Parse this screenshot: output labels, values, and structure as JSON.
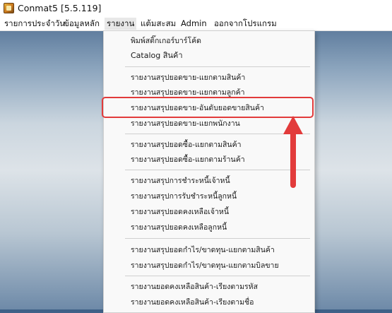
{
  "window": {
    "title": "Conmat5 [5.5.119]"
  },
  "menubar": {
    "items": [
      "รายการประจำวัน",
      "ข้อมูลหลัก",
      "รายงาน",
      "แต้มสะสม",
      "Admin",
      "ออกจากโปรแกรม"
    ],
    "active": "รายงาน"
  },
  "dropdown": {
    "items": [
      "พิมพ์สติ๊กเกอร์บาร์โค้ด",
      "Catalog สินค้า",
      "รายงานสรุปยอดขาย-แยกตามสินค้า",
      "รายงานสรุปยอดขาย-แยกตามลูกค้า",
      "รายงานสรุปยอดขาย-อันดับยอดขายสินค้า",
      "รายงานสรุปยอดขาย-แยกพนักงาน",
      "รายงานสรุปยอดซื้อ-แยกตามสินค้า",
      "รายงานสรุปยอดซื้อ-แยกตามร้านค้า",
      "รายงานสรุปการชำระหนี้เจ้าหนี้",
      "รายงานสรุปการรับชำระหนี้ลูกหนี้",
      "รายงานสรุปยอดคงเหลือเจ้าหนี้",
      "รายงานสรุปยอดคงเหลือลูกหนี้",
      "รายงานสรุปยอดกำไร/ขาดทุน-แยกตามสินค้า",
      "รายงานสรุปยอดกำไร/ขาดทุน-แยกตามบิลขาย",
      "รายงานยอดคงเหลือสินค้า-เรียงตามรหัส",
      "รายงานยอดคงเหลือสินค้า-เรียงตามชื่อ"
    ],
    "highlighted": "รายงานสรุปยอดขาย-อันดับยอดขายสินค้า"
  },
  "colors": {
    "annotation": "#e23b3b",
    "menu_bg": "#f9f9f9"
  },
  "icons": {
    "app": "conmat-app-icon",
    "annotation": "arrow-up-icon"
  }
}
